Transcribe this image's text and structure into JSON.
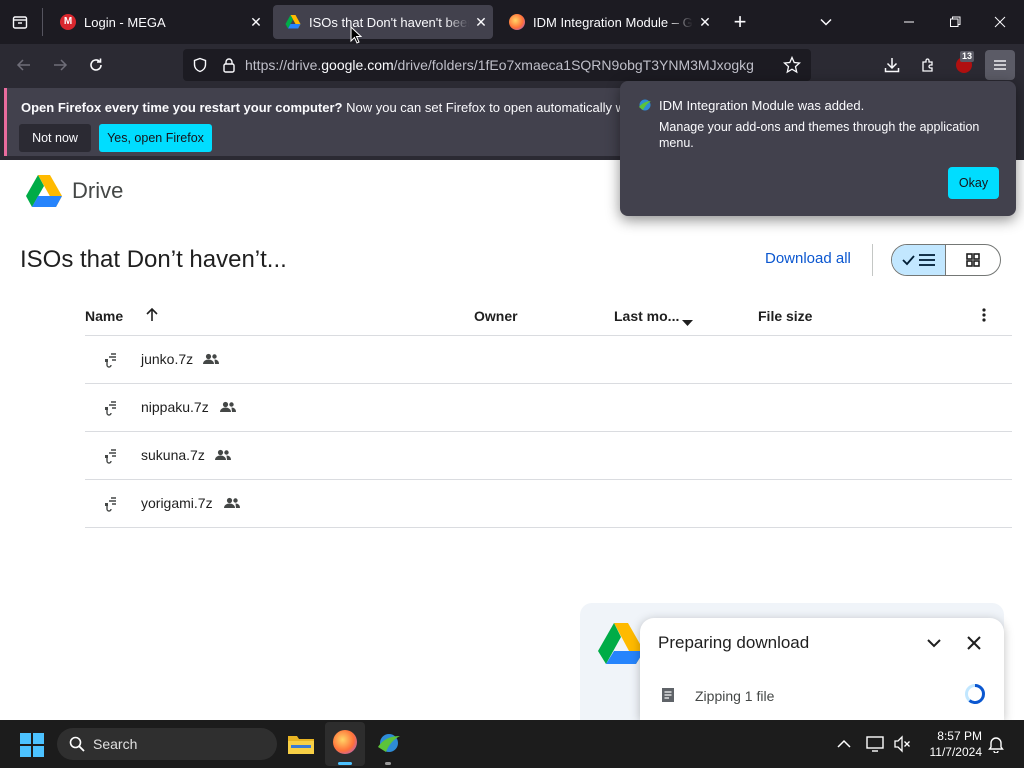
{
  "browser": {
    "tabs": [
      {
        "title": "Login - MEGA",
        "active": false
      },
      {
        "title": "ISOs that Don't haven't been a",
        "active": true
      },
      {
        "title": "IDM Integration Module – Get t",
        "active": false
      }
    ],
    "url": {
      "prefix": "https://drive.",
      "domain": "google.com",
      "path": "/drive/folders/1fEo7xmaeca1SQRN9obgT3YNM3MJxogkg"
    },
    "extension_badge": "13",
    "notification": {
      "bold": "Open Firefox every time you restart your computer?",
      "text": " Now you can set Firefox to open automatically when you r",
      "not_now": "Not now",
      "yes": "Yes, open Firefox"
    },
    "popup": {
      "title": "IDM Integration Module was added.",
      "body_line1": "Manage your add-ons and themes through the application",
      "body_line2": "menu.",
      "okay": "Okay"
    }
  },
  "drive": {
    "brand": "Drive",
    "folder_title": "ISOs that Don’t haven’t...",
    "download_all": "Download all",
    "columns": {
      "name": "Name",
      "owner": "Owner",
      "last_modified": "Last mo...",
      "file_size": "File size"
    },
    "files": [
      {
        "name": "junko.7z"
      },
      {
        "name": "nippaku.7z"
      },
      {
        "name": "sukuna.7z"
      },
      {
        "name": "yorigami.7z"
      }
    ],
    "download_panel": {
      "title": "Preparing download",
      "status": "Zipping 1 file"
    }
  },
  "taskbar": {
    "search": "Search",
    "time": "8:57 PM",
    "date": "11/7/2024"
  },
  "colors": {
    "accent_cyan": "#00ddff",
    "drive_blue": "#0b57d0",
    "toggle_bg": "#c2e7ff"
  }
}
